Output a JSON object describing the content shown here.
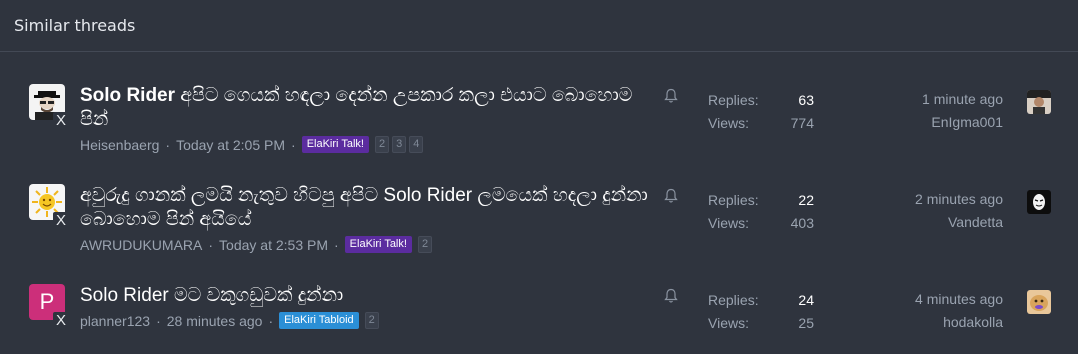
{
  "header": {
    "title": "Similar threads"
  },
  "threads": [
    {
      "avatar_letter": "",
      "title_prefix": "Solo Rider",
      "title_rest": " අපිට ගෙයක් හඳලා දෙන්න උපකාර කලා එයාට බොහොම පින්",
      "author": "Heisenbaerg",
      "date": "Today at 2:05 PM",
      "tag": "ElaKiri Talk!",
      "pages": [
        "2",
        "3",
        "4"
      ],
      "replies_label": "Replies:",
      "replies": "63",
      "views_label": "Views:",
      "views": "774",
      "last_time": "1 minute ago",
      "last_user": "EnIgma001"
    },
    {
      "avatar_letter": "",
      "title_prefix": "",
      "title_rest": "අවුරුදු ගානක් ලමයි නැතුව හිටපු අපිට Solo Rider ලමයෙක් හදලා දුන්නා බොහොම පින් අයියේ",
      "author": "AWRUDUKUMARA",
      "date": "Today at 2:53 PM",
      "tag": "ElaKiri Talk!",
      "pages": [
        "2"
      ],
      "replies_label": "Replies:",
      "replies": "22",
      "views_label": "Views:",
      "views": "403",
      "last_time": "2 minutes ago",
      "last_user": "Vandetta"
    },
    {
      "avatar_letter": "P",
      "title_prefix": "",
      "title_rest": "Solo Rider මට වකුගඩුවක් දුන්නා",
      "author": "planner123",
      "date": "28 minutes ago",
      "tag": "ElaKiri Tabloid",
      "pages": [
        "2"
      ],
      "replies_label": "Replies:",
      "replies": "24",
      "views_label": "Views:",
      "views": "25",
      "last_time": "4 minutes ago",
      "last_user": "hodakolla"
    }
  ],
  "x_mark": "X",
  "separator": "·",
  "colors": {
    "tag_talk": "#5b2c9f",
    "tag_tabloid": "#2b8fd6",
    "avatar_p": "#cc2f7a"
  }
}
